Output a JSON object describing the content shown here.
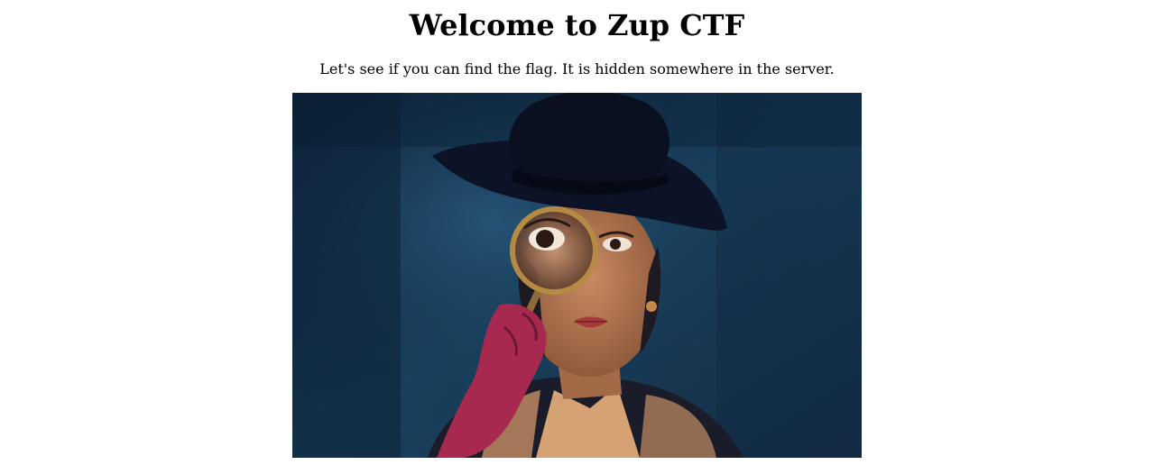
{
  "page": {
    "heading": "Welcome to Zup CTF",
    "subtitle": "Let's see if you can find the flag. It is hidden somewhere in the server."
  },
  "hero_image": {
    "subject": "detective-with-magnifying-glass",
    "colors": {
      "background": "#16324a",
      "hat": "#0c1326",
      "skin": "#b87a58",
      "glove": "#a8294f",
      "vest": "#1a1c2a",
      "shirt": "#d7a273",
      "lens_rim": "#b58a45"
    }
  }
}
